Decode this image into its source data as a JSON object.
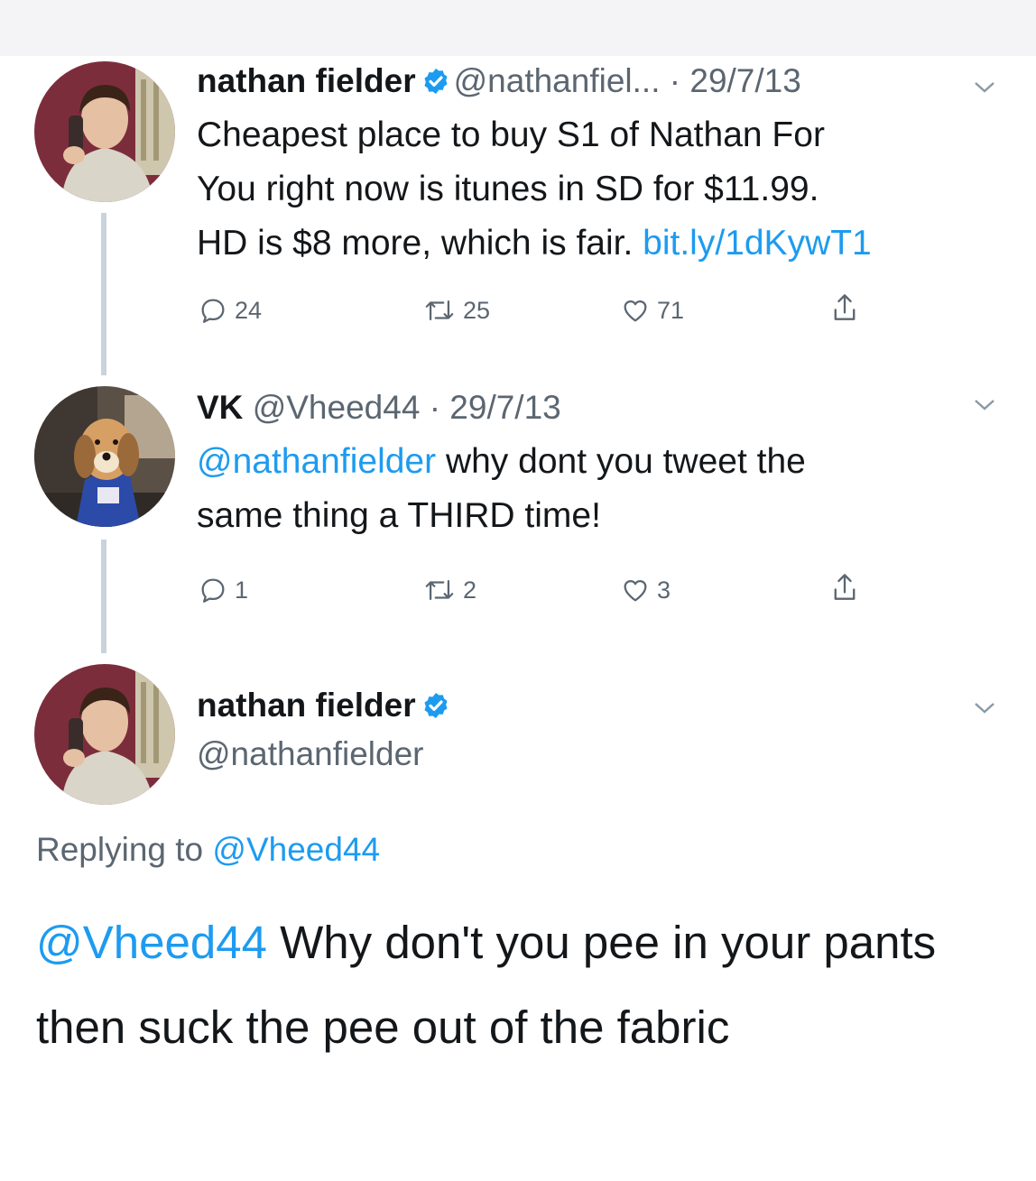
{
  "colors": {
    "link": "#1d9bf0",
    "muted": "#5b6671",
    "verified": "#1d9bf0",
    "thread_line": "#c8d3dc"
  },
  "tweet1": {
    "display_name": "nathan fielder",
    "handle": "@nathanfiel...",
    "date": "· 29/7/13",
    "verified_icon": "verified-badge-icon",
    "line1": "Cheapest place to buy S1 of Nathan For",
    "line2": "You right now is itunes in SD for $11.99.",
    "line3_text": "HD is $8 more, which is fair. ",
    "line3_link": "bit.ly/1dKywT1",
    "replies": "24",
    "retweets": "25",
    "likes": "71"
  },
  "tweet2": {
    "display_name": "VK",
    "handle": "@Vheed44",
    "date": "· 29/7/13",
    "mention": "@nathanfielder",
    "line1_text": " why dont you tweet the",
    "line2": "same thing a THIRD time!",
    "replies": "1",
    "retweets": "2",
    "likes": "3"
  },
  "tweet3": {
    "display_name": "nathan fielder",
    "handle": "@nathanfielder",
    "replying_label": "Replying to ",
    "replying_handle": "@Vheed44",
    "mention": "@Vheed44",
    "text": " Why don't you pee in your pants then suck the pee out of the fabric"
  },
  "icons": {
    "reply": "reply-icon",
    "retweet": "retweet-icon",
    "like": "heart-icon",
    "share": "share-icon",
    "more": "chevron-down-icon"
  }
}
